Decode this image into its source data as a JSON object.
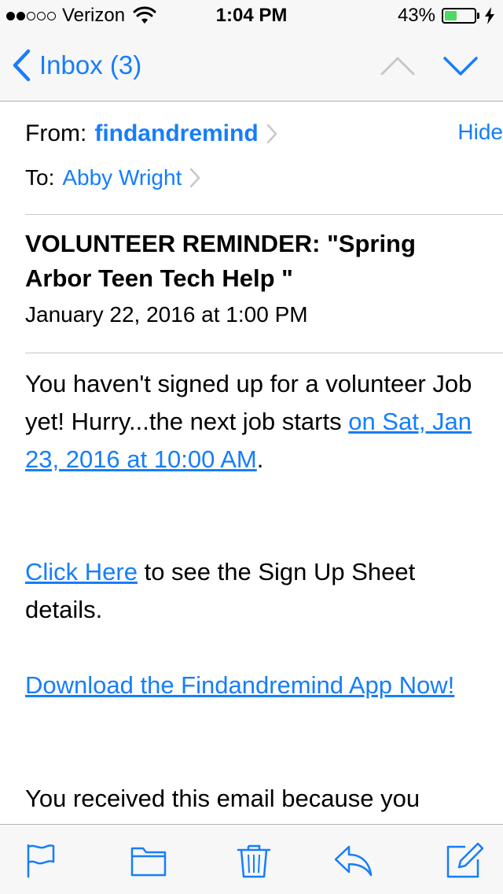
{
  "status_bar": {
    "carrier": "Verizon",
    "time": "1:04 PM",
    "battery_percent": "43%",
    "battery_level": 0.43,
    "signal_bars_filled": 2,
    "signal_bars_total": 5
  },
  "nav": {
    "back_label": "Inbox (3)",
    "back_icon": "chevron-left-icon",
    "prev_icon": "chevron-up-icon",
    "next_icon": "chevron-down-icon"
  },
  "header": {
    "from_label": "From:",
    "from_name": "findandremind",
    "hide_label": "Hide",
    "to_label": "To:",
    "to_name": "Abby Wright",
    "subject": "VOLUNTEER REMINDER: \"Spring Arbor Teen Tech Help \"",
    "date": "January 22, 2016 at 1:00 PM"
  },
  "body": {
    "p1_text": "You haven't signed up for a volunteer Job yet! Hurry...the next job starts ",
    "p1_link": "on Sat, Jan 23, 2016 at 10:00 AM",
    "p1_end": ".",
    "p2_link": "Click Here",
    "p2_text": " to see the Sign Up Sheet details.",
    "p3_link": "Download the Findandremind App Now!",
    "p4_text": "You received this email because you"
  },
  "toolbar": {
    "items": [
      "flag-icon",
      "folder-icon",
      "trash-icon",
      "reply-icon",
      "compose-icon"
    ]
  },
  "colors": {
    "accent": "#157efb",
    "battery": "#4cd964",
    "bar_bg": "#f7f7f8"
  }
}
